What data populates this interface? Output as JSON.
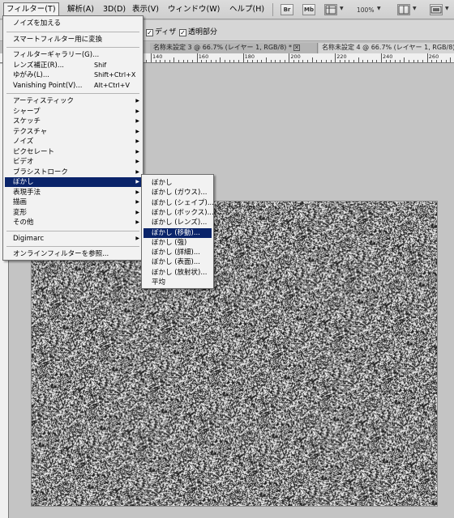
{
  "menubar": {
    "items": [
      {
        "label": "フィルター(T)",
        "active": true
      },
      {
        "label": "解析(A)"
      },
      {
        "label": "3D(D)"
      },
      {
        "label": "表示(V)"
      },
      {
        "label": "ウィンドウ(W)"
      },
      {
        "label": "ヘルプ(H)"
      }
    ],
    "bridge_label": "Br",
    "minibridge_label": "Mb",
    "zoom": "100%"
  },
  "options": {
    "dither_label": "ディザ",
    "transparency_label": "透明部分"
  },
  "tabs": [
    {
      "label": "名称未設定 3 @ 66.7% (レイヤー 1, RGB/8) *"
    },
    {
      "label": "名称未設定 4 @ 66.7% (レイヤー 1, RGB/8)"
    }
  ],
  "ruler": {
    "labels": [
      "140",
      "160",
      "180",
      "200",
      "220",
      "240",
      "260",
      "280",
      "300",
      "320",
      "340",
      "360",
      "380",
      "400",
      "420",
      "440"
    ]
  },
  "filter_menu": {
    "items": [
      {
        "label": "ノイズを加える"
      },
      {
        "sep": true
      },
      {
        "label": "スマートフィルター用に変換"
      },
      {
        "sep": true
      },
      {
        "label": "フィルターギャラリー(G)..."
      },
      {
        "label": "レンズ補正(R)...",
        "shortcut": "Shif"
      },
      {
        "label": "ゆがみ(L)...",
        "shortcut": "Shift+Ctrl+X"
      },
      {
        "label": "Vanishing Point(V)...",
        "shortcut": "Alt+Ctrl+V"
      },
      {
        "sep": true
      },
      {
        "label": "アーティスティック",
        "submenu": true
      },
      {
        "label": "シャープ",
        "submenu": true
      },
      {
        "label": "スケッチ",
        "submenu": true
      },
      {
        "label": "テクスチャ",
        "submenu": true
      },
      {
        "label": "ノイズ",
        "submenu": true
      },
      {
        "label": "ピクセレート",
        "submenu": true
      },
      {
        "label": "ビデオ",
        "submenu": true
      },
      {
        "label": "ブラシストローク",
        "submenu": true
      },
      {
        "label": "ぼかし",
        "submenu": true,
        "selected": true
      },
      {
        "label": "表現手法",
        "submenu": true
      },
      {
        "label": "描画",
        "submenu": true
      },
      {
        "label": "変形",
        "submenu": true
      },
      {
        "label": "その他",
        "submenu": true
      },
      {
        "sep": true
      },
      {
        "label": "Digimarc",
        "submenu": true
      },
      {
        "sep": true
      },
      {
        "label": "オンラインフィルターを参照..."
      }
    ]
  },
  "blur_submenu": {
    "items": [
      {
        "label": "ぼかし"
      },
      {
        "label": "ぼかし (ガウス)..."
      },
      {
        "label": "ぼかし (シェイプ)..."
      },
      {
        "label": "ぼかし (ボックス)..."
      },
      {
        "label": "ぼかし (レンズ)..."
      },
      {
        "label": "ぼかし (移動)...",
        "selected": true
      },
      {
        "label": "ぼかし (強)"
      },
      {
        "label": "ぼかし (詳細)..."
      },
      {
        "label": "ぼかし (表面)..."
      },
      {
        "label": "ぼかし (放射状)..."
      },
      {
        "label": "平均"
      }
    ]
  }
}
